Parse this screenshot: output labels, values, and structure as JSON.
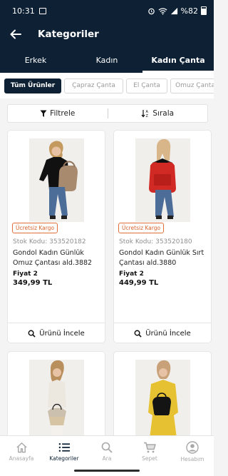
{
  "status_bar": {
    "time": "10:31",
    "battery": "%82"
  },
  "app_bar": {
    "title": "Kategoriler"
  },
  "tabs": [
    {
      "label": "Erkek",
      "active": false
    },
    {
      "label": "Kadın",
      "active": false
    },
    {
      "label": "Kadın Çanta",
      "active": true
    }
  ],
  "chips": [
    {
      "label": "Tüm Ürünler",
      "active": true
    },
    {
      "label": "Çapraz Çanta",
      "active": false
    },
    {
      "label": "El Çanta",
      "active": false
    },
    {
      "label": "Omuz Çanta",
      "active": false
    }
  ],
  "filter_bar": {
    "filter_label": "Filtrele",
    "sort_label": "Sırala"
  },
  "products": [
    {
      "badge": "Ücretsiz Kargo",
      "sku": "Stok Kodu: 353520182",
      "name": "Gondol Kadın Günlük Omuz Çantası ald.3882",
      "price_label": "Fiyat 2",
      "price": "349,99 TL",
      "cta": "Ürünü İncele"
    },
    {
      "badge": "Ücretsiz Kargo",
      "sku": "Stok Kodu: 353520180",
      "name": "Gondol Kadın Günlük Sırt Çantası ald.3880",
      "price_label": "Fiyat 2",
      "price": "449,99 TL",
      "cta": "Ürünü İncele"
    }
  ],
  "bottom_nav": [
    {
      "label": "Anasayfa",
      "icon": "home-icon",
      "active": false
    },
    {
      "label": "Kategoriler",
      "icon": "list-icon",
      "active": true
    },
    {
      "label": "Ara",
      "icon": "search-icon",
      "active": false
    },
    {
      "label": "Sepet",
      "icon": "cart-icon",
      "active": false
    },
    {
      "label": "Hesabım",
      "icon": "account-icon",
      "active": false
    }
  ],
  "colors": {
    "brand_navy": "#0d2034",
    "badge_orange": "#e36f3c",
    "page_bg": "#f4f4f5"
  }
}
